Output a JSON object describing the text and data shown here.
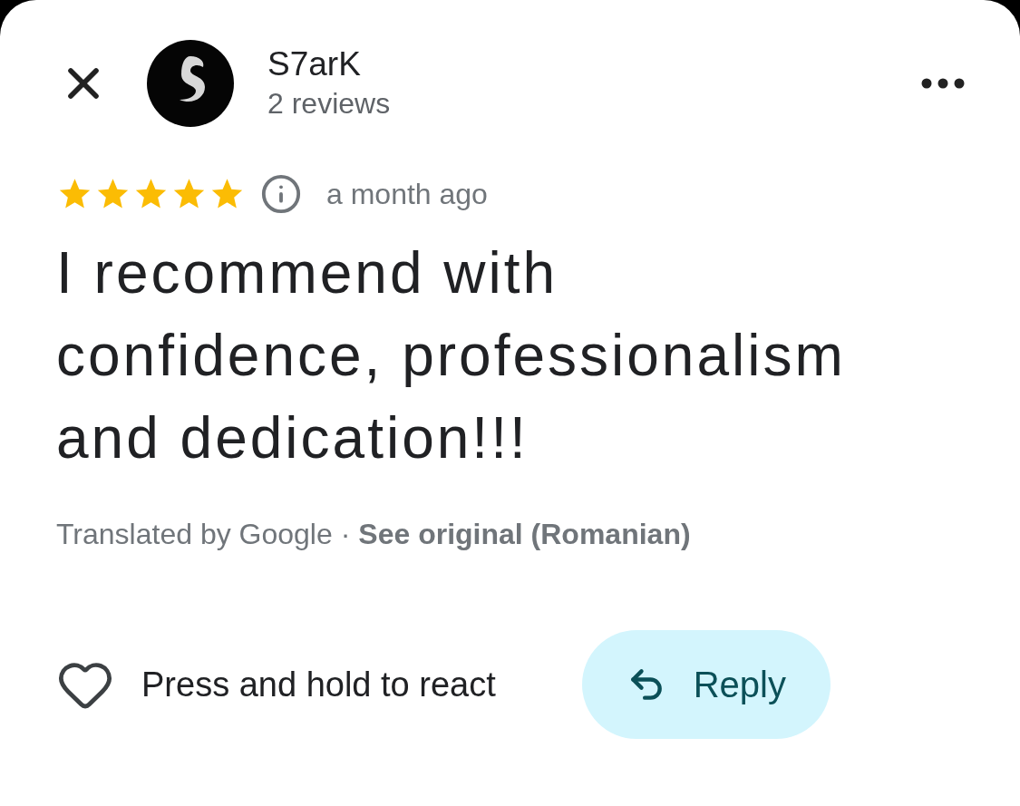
{
  "reviewer": {
    "name": "S7arK",
    "review_count": "2 reviews"
  },
  "review": {
    "stars": 5,
    "time": "a month ago",
    "text": "I recommend with confidence, professionalism and dedication!!!"
  },
  "translation": {
    "note": "Translated by Google ·",
    "link": "See original (Romanian)"
  },
  "actions": {
    "react": "Press and hold to react",
    "reply": "Reply"
  }
}
